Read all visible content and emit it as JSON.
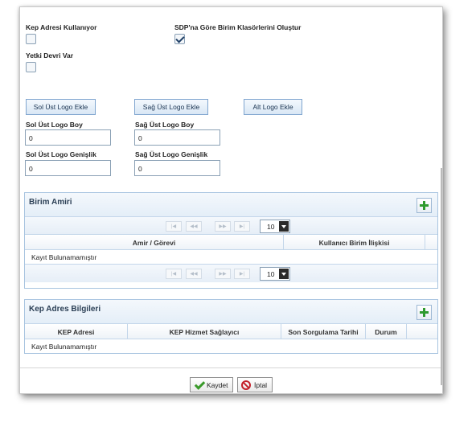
{
  "form": {
    "kep_kullaniliyor_label": "Kep Adresi Kullanıyor",
    "kep_kullaniliyor_checked": false,
    "sdp_label": "SDP'na Göre Birim Klasörlerini Oluştur",
    "sdp_checked": true,
    "yetki_label": "Yetki Devri Var",
    "yetki_checked": false,
    "logo_buttons": [
      "Sol Üst Logo Ekle",
      "Sağ Üst Logo Ekle",
      "Alt Logo Ekle"
    ],
    "sol_boy_label": "Sol Üst Logo Boy",
    "sol_boy_value": "0",
    "sag_boy_label": "Sağ Üst Logo Boy",
    "sag_boy_value": "0",
    "sol_genislik_label": "Sol Üst Logo Genişlik",
    "sol_genislik_value": "0",
    "sag_genislik_label": "Sağ Üst Logo Genişlik",
    "sag_genislik_value": "0"
  },
  "birim_amiri": {
    "title": "Birim Amiri",
    "pager": {
      "first": "|◀",
      "prev": "◀◀",
      "next": "▶▶",
      "last": "▶|",
      "page_size": "10"
    },
    "columns": [
      "Amir / Görevi",
      "Kullanıcı Birim İlişkisi"
    ],
    "empty_text": "Kayıt Bulunamamıştır"
  },
  "kep_adres": {
    "title": "Kep Adres Bilgileri",
    "columns": [
      "KEP Adresi",
      "KEP Hizmet Sağlayıcı",
      "Son Sorgulama Tarihi",
      "Durum"
    ],
    "empty_text": "Kayıt Bulunamamıştır"
  },
  "footer": {
    "save_label": "Kaydet",
    "cancel_label": "İptal"
  },
  "icons": {
    "add": "plus-icon",
    "save": "check-icon",
    "cancel": "cancel-icon",
    "dropdown": "chevron-down-icon"
  },
  "colors": {
    "accent_border": "#7fa5cf",
    "add_icon": "#2e9a2e",
    "cancel_icon": "#c4202a"
  }
}
